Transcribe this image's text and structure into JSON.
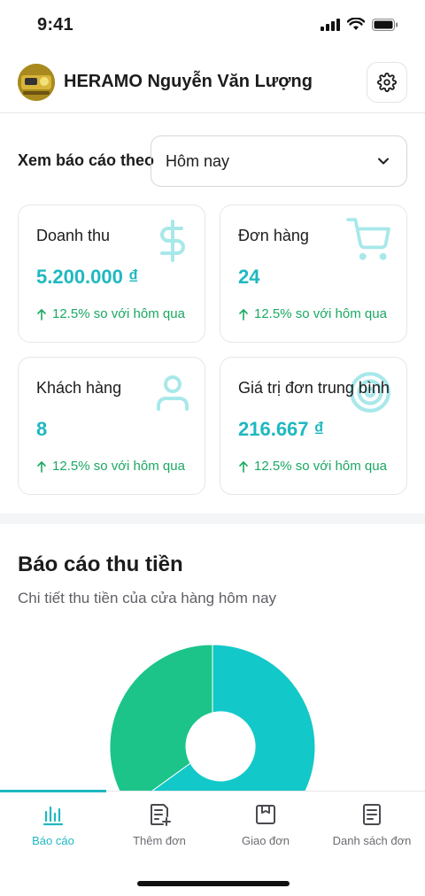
{
  "status_bar": {
    "time": "9:41"
  },
  "header": {
    "shop_name": "HERAMO Nguyễn Văn Lượng"
  },
  "filter": {
    "label": "Xem báo cáo theo",
    "selected": "Hôm nay"
  },
  "stats": [
    {
      "title": "Doanh thu",
      "value": "5.200.000 ₫",
      "change": "12.5% so với hôm qua",
      "icon": "dollar-icon"
    },
    {
      "title": "Đơn hàng",
      "value": "24",
      "change": "12.5% so với hôm qua",
      "icon": "cart-icon"
    },
    {
      "title": "Khách hàng",
      "value": "8",
      "change": "12.5% so với hôm qua",
      "icon": "user-icon"
    },
    {
      "title": "Giá trị đơn trung bình",
      "value": "216.667 ₫",
      "change": "12.5% so với hôm qua",
      "icon": "target-icon"
    }
  ],
  "collection_report": {
    "title": "Báo cáo thu tiền",
    "subtitle": "Chi tiết thu tiền của cửa hàng hôm nay",
    "chart_colors": [
      "#13c8c8",
      "#1cc48a"
    ]
  },
  "tabs": [
    {
      "label": "Báo cáo",
      "icon": "bar-chart-icon",
      "active": true
    },
    {
      "label": "Thêm đơn",
      "icon": "add-order-icon",
      "active": false
    },
    {
      "label": "Giao đơn",
      "icon": "package-icon",
      "active": false
    },
    {
      "label": "Danh sách đơn",
      "icon": "order-list-icon",
      "active": false
    }
  ],
  "colors": {
    "accent": "#1fb8c0",
    "positive": "#1ba862"
  }
}
